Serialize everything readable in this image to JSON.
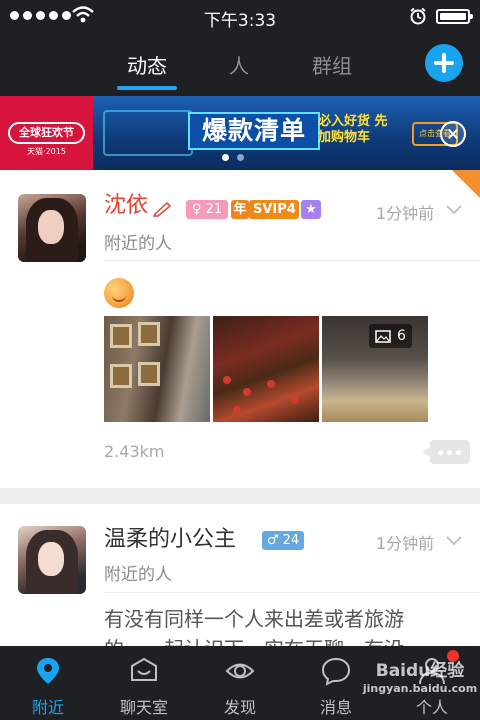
{
  "status_bar": {
    "time": "下午3:33",
    "battery_level": 1.0
  },
  "top_nav": {
    "tabs": [
      {
        "label": "动态",
        "active": true
      },
      {
        "label": "人",
        "active": false
      },
      {
        "label": "群组",
        "active": false
      }
    ],
    "add_icon": "plus-icon"
  },
  "banner": {
    "logo_text": "全球狂欢节",
    "logo_sub": "天猫·2015",
    "headline": "爆款清单",
    "slogan": "必入好货 先加购物车",
    "cta": "点击查看",
    "page_dots": 2,
    "active_dot": 0
  },
  "feed": {
    "post1": {
      "name": "沈依",
      "subtitle": "附近的人",
      "age_badge": "21",
      "year_badge": "年",
      "vip_badge": "SVIP4",
      "time_ago": "1分钟前",
      "photo_count": "6",
      "distance": "2.43km"
    },
    "post2": {
      "name": "温柔的小公主",
      "subtitle": "附近的人",
      "age_badge": "24",
      "time_ago": "1分钟前",
      "text": "有没有同样一个人来出差或者旅游的……起认识下，实在无聊，有没"
    }
  },
  "bottom_bar": {
    "tabs": [
      {
        "label": "附近",
        "icon": "location-pin-icon",
        "active": true
      },
      {
        "label": "聊天室",
        "icon": "chat-room-icon",
        "active": false
      },
      {
        "label": "发现",
        "icon": "eye-icon",
        "active": false
      },
      {
        "label": "消息",
        "icon": "message-bubble-icon",
        "active": false
      },
      {
        "label": "个人",
        "icon": "person-icon",
        "active": false
      }
    ]
  },
  "watermark": {
    "brand": "Baidu经验",
    "url": "jingyan.baidu.com"
  },
  "colors": {
    "dark_bar": "#1f2024",
    "accent_blue": "#1aa3ee",
    "name_red": "#e2422f",
    "vip_orange": "#ef8a17",
    "female_pink": "#f59bb9",
    "male_blue": "#66a7de"
  }
}
